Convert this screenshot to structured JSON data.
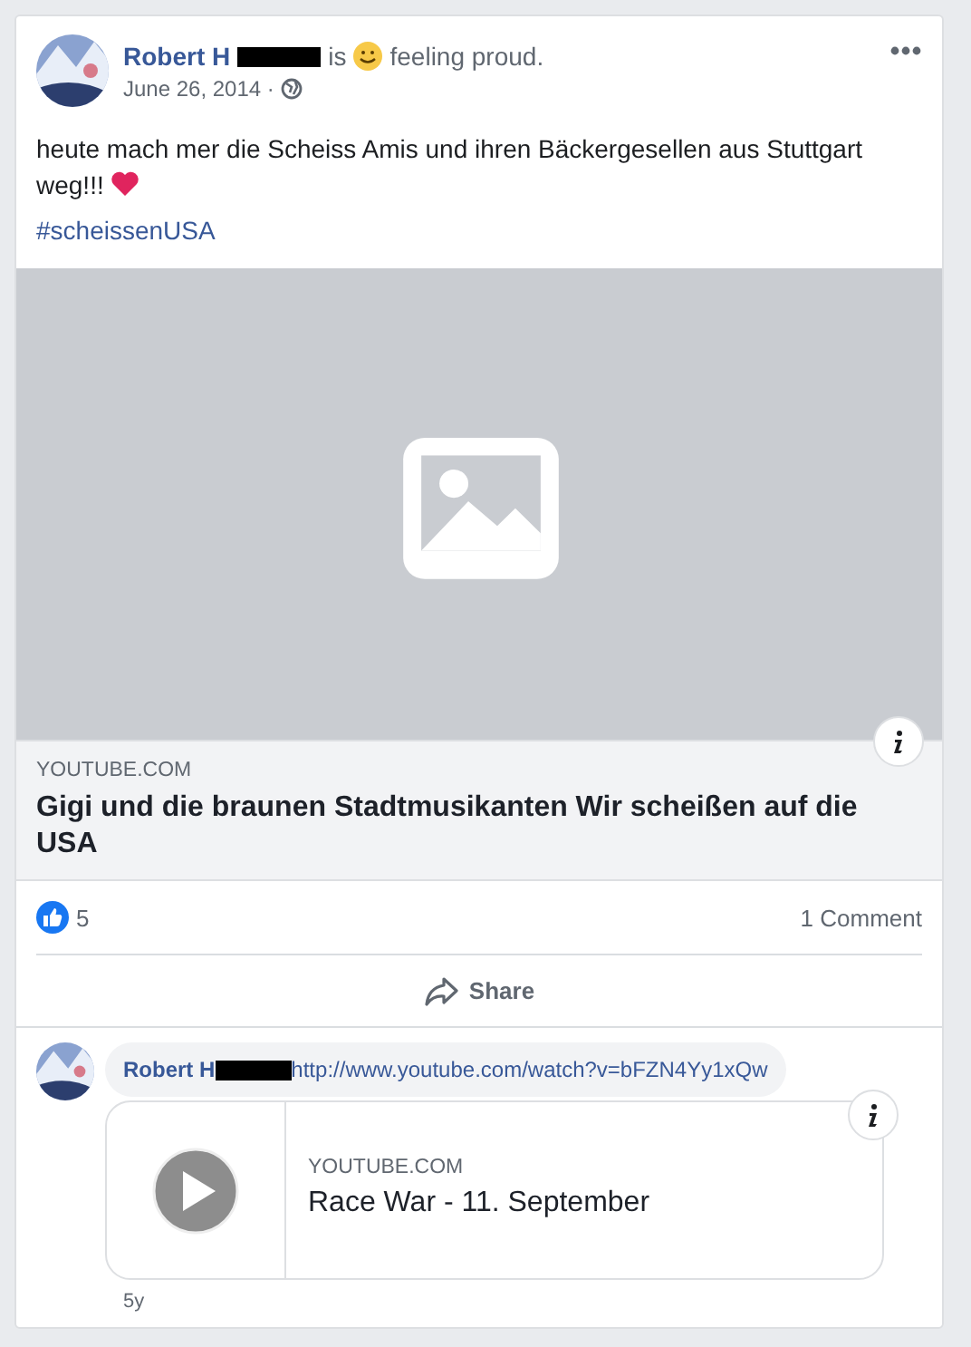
{
  "post": {
    "author": "Robert H",
    "is": "is",
    "feeling": "feeling proud.",
    "date": "June 26, 2014 ·",
    "text": "heute mach mer die Scheiss Amis und ihren Bäckergesellen aus Stuttgart weg!!!",
    "hashtag": "#scheissenUSA"
  },
  "link_preview": {
    "kind": "picture",
    "domain": "YOUTUBE.COM",
    "title": "Gigi und die braunen Stadtmusikanten Wir scheißen auf die USA"
  },
  "reactions": {
    "likes": "5",
    "comments": "1 Comment"
  },
  "actions": [
    {
      "label": "Share"
    }
  ],
  "comment": {
    "author": "Robert H",
    "link": "http://www.youtube.com/watch?v=bFZN4Yy1xQw",
    "attachment": {
      "domain": "YOUTUBE.COM",
      "title": "Race War - 11. September"
    },
    "time": "5y"
  }
}
